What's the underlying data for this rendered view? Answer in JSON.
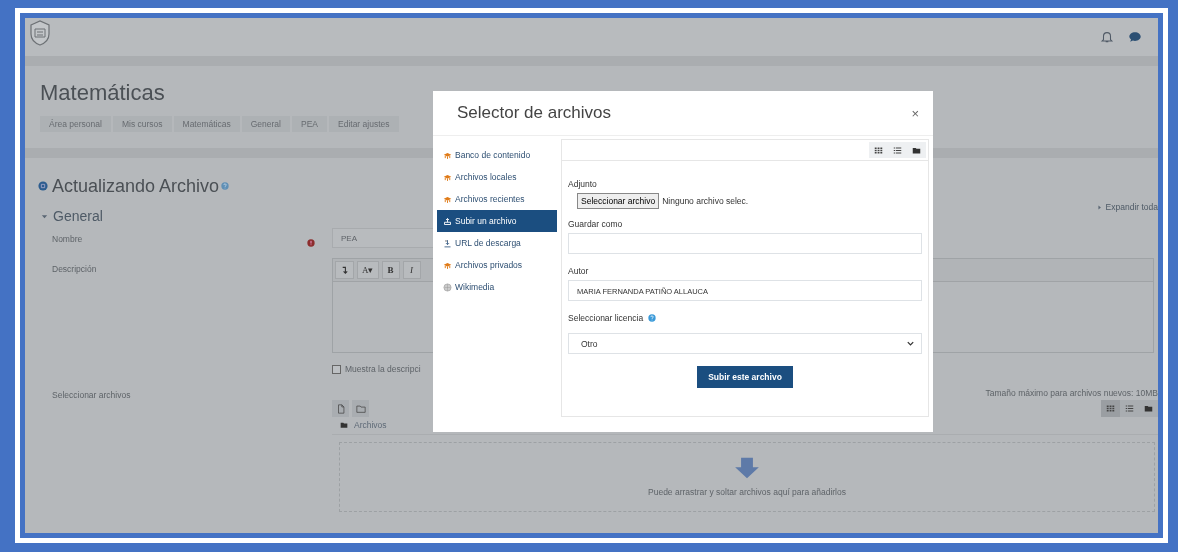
{
  "header": {
    "title": "Matemáticas",
    "breadcrumb": [
      "Área personal",
      "Mis cursos",
      "Matemáticas",
      "General",
      "PEA",
      "Editar ajustes"
    ]
  },
  "page": {
    "heading": "Actualizando Archivo",
    "expand_link": "Expandir toda",
    "section": {
      "title": "General",
      "expanded": true
    },
    "name_field": {
      "label": "Nombre",
      "required": true,
      "value": "PEA"
    },
    "description": {
      "label": "Descripción",
      "toolbar": [
        {
          "kind": "icon"
        },
        {
          "kind": "text",
          "label": "A▾"
        },
        {
          "kind": "text",
          "label": "B"
        },
        {
          "kind": "text",
          "label": "I"
        }
      ]
    },
    "show_description": {
      "label": "Muestra la descripci",
      "checked": false
    },
    "files": {
      "label": "Seleccionar archivos",
      "max_size": "Tamaño máximo para archivos nuevos: 10MB",
      "folder": "Archivos",
      "drop_hint": "Puede arrastrar y soltar archivos aquí para añadirlos"
    }
  },
  "modal": {
    "title": "Selector de archivos",
    "close": "×",
    "repositories": [
      {
        "kind": "moodle",
        "label": "Banco de contenido",
        "selected": false
      },
      {
        "kind": "moodle",
        "label": "Archivos locales",
        "selected": false
      },
      {
        "kind": "moodle",
        "label": "Archivos recientes",
        "selected": false
      },
      {
        "kind": "upload",
        "label": "Subir un archivo",
        "selected": true
      },
      {
        "kind": "url",
        "label": "URL de descarga",
        "selected": false
      },
      {
        "kind": "moodle",
        "label": "Archivos privados",
        "selected": false
      },
      {
        "kind": "wikimedia",
        "label": "Wikimedia",
        "selected": false
      }
    ],
    "attachment_label": "Adjunto",
    "file_button": "Seleccionar archivo",
    "file_status": "Ninguno archivo selec.",
    "save_as_label": "Guardar como",
    "author_label": "Autor",
    "author_value": "MARIA FERNANDA PATIÑO ALLAUCA",
    "license_label": "Seleccionar licencia",
    "license_value": "Otro",
    "submit": "Subir este archivo"
  }
}
